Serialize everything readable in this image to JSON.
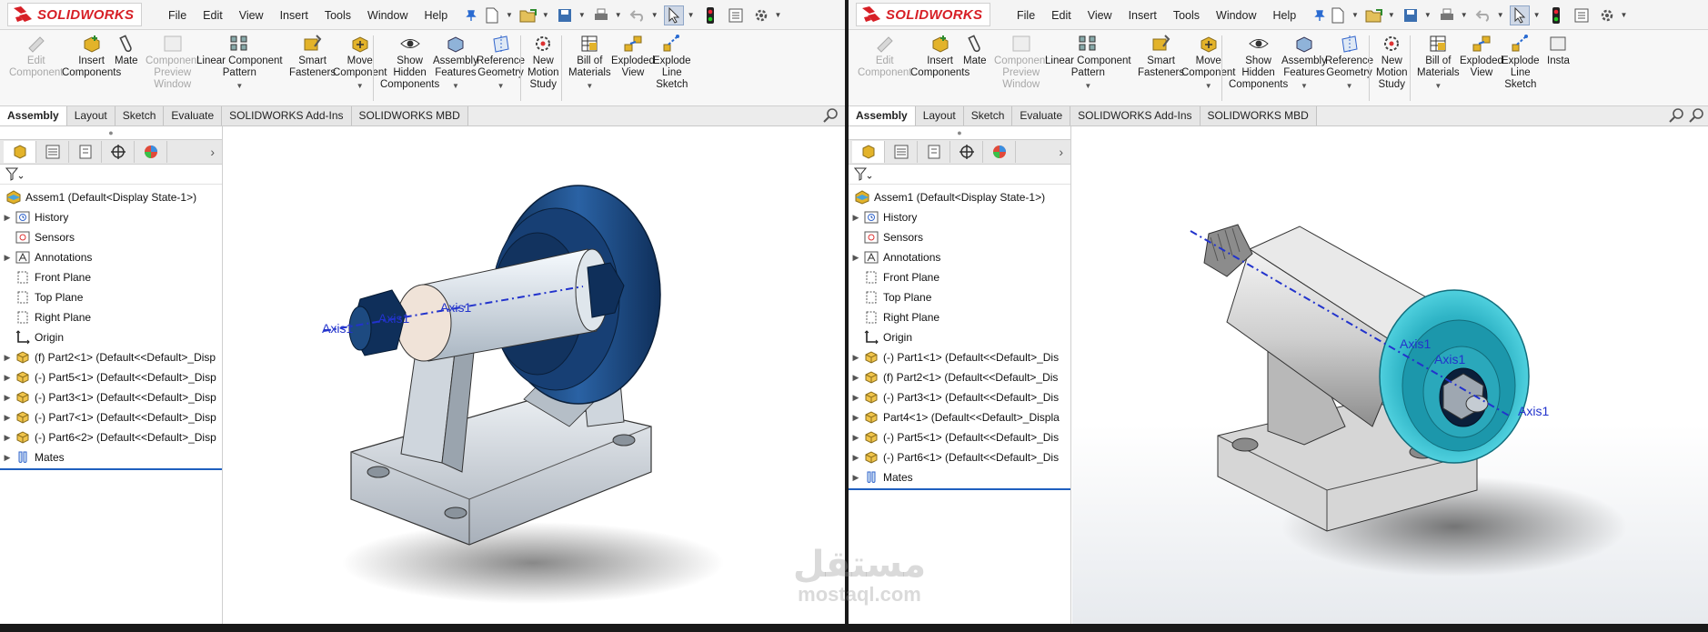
{
  "app": {
    "brand": "SOLIDWORKS",
    "menu": [
      "File",
      "Edit",
      "View",
      "Insert",
      "Tools",
      "Window",
      "Help"
    ]
  },
  "left_pane": {
    "commands": [
      {
        "label": "Edit\nComponent",
        "enabled": false
      },
      {
        "label": "Insert\nComponents",
        "enabled": true
      },
      {
        "label": "Mate",
        "enabled": true
      },
      {
        "label": "Component\nPreview\nWindow",
        "enabled": false
      },
      {
        "label": "Linear Component\nPattern",
        "enabled": true
      },
      {
        "label": "Smart\nFasteners",
        "enabled": true
      },
      {
        "label": "Move\nComponent",
        "enabled": true
      },
      {
        "label": "Show\nHidden\nComponents",
        "enabled": true
      },
      {
        "label": "Assembly\nFeatures",
        "enabled": true
      },
      {
        "label": "Reference\nGeometry",
        "enabled": true
      },
      {
        "label": "New\nMotion\nStudy",
        "enabled": true
      },
      {
        "label": "Bill of\nMaterials",
        "enabled": true
      },
      {
        "label": "Exploded\nView",
        "enabled": true
      },
      {
        "label": "Explode\nLine\nSketch",
        "enabled": true
      }
    ],
    "tabs": [
      "Assembly",
      "Layout",
      "Sketch",
      "Evaluate",
      "SOLIDWORKS Add-Ins",
      "SOLIDWORKS MBD"
    ],
    "active_tab": "Assembly",
    "tree": [
      {
        "label": "Assem1  (Default<Display State-1>)",
        "icon": "assembly-icon",
        "expand": false
      },
      {
        "label": "History",
        "icon": "history-icon",
        "expand": true
      },
      {
        "label": "Sensors",
        "icon": "sensor-icon",
        "expand": false
      },
      {
        "label": "Annotations",
        "icon": "annotation-icon",
        "expand": true
      },
      {
        "label": "Front Plane",
        "icon": "plane-icon",
        "expand": false
      },
      {
        "label": "Top Plane",
        "icon": "plane-icon",
        "expand": false
      },
      {
        "label": "Right Plane",
        "icon": "plane-icon",
        "expand": false
      },
      {
        "label": "Origin",
        "icon": "origin-icon",
        "expand": false
      },
      {
        "label": "(f) Part2<1> (Default<<Default>_Disp",
        "icon": "part-icon",
        "expand": true
      },
      {
        "label": "(-) Part5<1> (Default<<Default>_Disp",
        "icon": "part-icon",
        "expand": true
      },
      {
        "label": "(-) Part3<1> (Default<<Default>_Disp",
        "icon": "part-icon",
        "expand": true
      },
      {
        "label": "(-) Part7<1> (Default<<Default>_Disp",
        "icon": "part-icon",
        "expand": true
      },
      {
        "label": "(-) Part6<2> (Default<<Default>_Disp",
        "icon": "part-icon",
        "expand": true
      },
      {
        "label": "Mates",
        "icon": "mates-icon",
        "expand": true
      }
    ],
    "axis_labels": [
      "Axis1",
      "Axis1",
      "Axis1"
    ]
  },
  "right_pane": {
    "commands": [
      {
        "label": "Edit\nComponent",
        "enabled": false
      },
      {
        "label": "Insert\nComponents",
        "enabled": true
      },
      {
        "label": "Mate",
        "enabled": true
      },
      {
        "label": "Component\nPreview\nWindow",
        "enabled": false
      },
      {
        "label": "Linear Component\nPattern",
        "enabled": true
      },
      {
        "label": "Smart\nFasteners",
        "enabled": true
      },
      {
        "label": "Move\nComponent",
        "enabled": true
      },
      {
        "label": "Show\nHidden\nComponents",
        "enabled": true
      },
      {
        "label": "Assembly\nFeatures",
        "enabled": true
      },
      {
        "label": "Reference\nGeometry",
        "enabled": true
      },
      {
        "label": "New\nMotion\nStudy",
        "enabled": true
      },
      {
        "label": "Bill of\nMaterials",
        "enabled": true
      },
      {
        "label": "Exploded\nView",
        "enabled": true
      },
      {
        "label": "Explode\nLine\nSketch",
        "enabled": true
      },
      {
        "label": "Insta",
        "enabled": true
      }
    ],
    "tabs": [
      "Assembly",
      "Layout",
      "Sketch",
      "Evaluate",
      "SOLIDWORKS Add-Ins",
      "SOLIDWORKS MBD"
    ],
    "active_tab": "Assembly",
    "tree": [
      {
        "label": "Assem1  (Default<Display State-1>)",
        "icon": "assembly-icon",
        "expand": false
      },
      {
        "label": "History",
        "icon": "history-icon",
        "expand": true
      },
      {
        "label": "Sensors",
        "icon": "sensor-icon",
        "expand": false
      },
      {
        "label": "Annotations",
        "icon": "annotation-icon",
        "expand": true
      },
      {
        "label": "Front Plane",
        "icon": "plane-icon",
        "expand": false
      },
      {
        "label": "Top Plane",
        "icon": "plane-icon",
        "expand": false
      },
      {
        "label": "Right Plane",
        "icon": "plane-icon",
        "expand": false
      },
      {
        "label": "Origin",
        "icon": "origin-icon",
        "expand": false
      },
      {
        "label": "(-) Part1<1> (Default<<Default>_Dis",
        "icon": "part-icon",
        "expand": true
      },
      {
        "label": "(f) Part2<1> (Default<<Default>_Dis",
        "icon": "part-icon",
        "expand": true
      },
      {
        "label": "(-) Part3<1> (Default<<Default>_Dis",
        "icon": "part-icon",
        "expand": true
      },
      {
        "label": "Part4<1> (Default<<Default>_Displa",
        "icon": "part-icon",
        "expand": true
      },
      {
        "label": "(-) Part5<1> (Default<<Default>_Dis",
        "icon": "part-icon",
        "expand": true
      },
      {
        "label": "(-) Part6<1> (Default<<Default>_Dis",
        "icon": "part-icon",
        "expand": true
      },
      {
        "label": "Mates",
        "icon": "mates-icon",
        "expand": true
      }
    ],
    "axis_labels": [
      "Axis1",
      "Axis1",
      "Axis1"
    ]
  },
  "watermark": {
    "arabic": "مستقل",
    "latin": "mostaql.com"
  },
  "colors": {
    "brand_red": "#d71f26",
    "wheel_left": "#1f4f8a",
    "wheel_right": "#2fb4c6",
    "axis": "#2233cc"
  }
}
